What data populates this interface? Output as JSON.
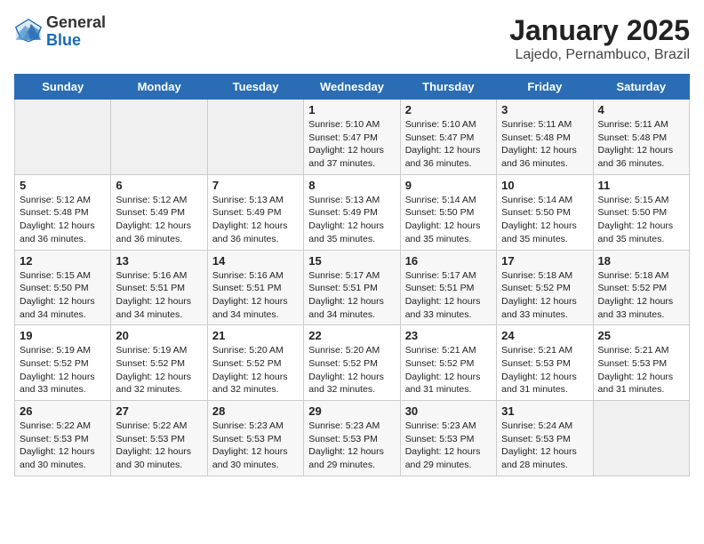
{
  "logo": {
    "general": "General",
    "blue": "Blue"
  },
  "title": "January 2025",
  "subtitle": "Lajedo, Pernambuco, Brazil",
  "weekdays": [
    "Sunday",
    "Monday",
    "Tuesday",
    "Wednesday",
    "Thursday",
    "Friday",
    "Saturday"
  ],
  "weeks": [
    [
      {
        "day": "",
        "info": ""
      },
      {
        "day": "",
        "info": ""
      },
      {
        "day": "",
        "info": ""
      },
      {
        "day": "1",
        "info": "Sunrise: 5:10 AM\nSunset: 5:47 PM\nDaylight: 12 hours\nand 37 minutes."
      },
      {
        "day": "2",
        "info": "Sunrise: 5:10 AM\nSunset: 5:47 PM\nDaylight: 12 hours\nand 36 minutes."
      },
      {
        "day": "3",
        "info": "Sunrise: 5:11 AM\nSunset: 5:48 PM\nDaylight: 12 hours\nand 36 minutes."
      },
      {
        "day": "4",
        "info": "Sunrise: 5:11 AM\nSunset: 5:48 PM\nDaylight: 12 hours\nand 36 minutes."
      }
    ],
    [
      {
        "day": "5",
        "info": "Sunrise: 5:12 AM\nSunset: 5:48 PM\nDaylight: 12 hours\nand 36 minutes."
      },
      {
        "day": "6",
        "info": "Sunrise: 5:12 AM\nSunset: 5:49 PM\nDaylight: 12 hours\nand 36 minutes."
      },
      {
        "day": "7",
        "info": "Sunrise: 5:13 AM\nSunset: 5:49 PM\nDaylight: 12 hours\nand 36 minutes."
      },
      {
        "day": "8",
        "info": "Sunrise: 5:13 AM\nSunset: 5:49 PM\nDaylight: 12 hours\nand 35 minutes."
      },
      {
        "day": "9",
        "info": "Sunrise: 5:14 AM\nSunset: 5:50 PM\nDaylight: 12 hours\nand 35 minutes."
      },
      {
        "day": "10",
        "info": "Sunrise: 5:14 AM\nSunset: 5:50 PM\nDaylight: 12 hours\nand 35 minutes."
      },
      {
        "day": "11",
        "info": "Sunrise: 5:15 AM\nSunset: 5:50 PM\nDaylight: 12 hours\nand 35 minutes."
      }
    ],
    [
      {
        "day": "12",
        "info": "Sunrise: 5:15 AM\nSunset: 5:50 PM\nDaylight: 12 hours\nand 34 minutes."
      },
      {
        "day": "13",
        "info": "Sunrise: 5:16 AM\nSunset: 5:51 PM\nDaylight: 12 hours\nand 34 minutes."
      },
      {
        "day": "14",
        "info": "Sunrise: 5:16 AM\nSunset: 5:51 PM\nDaylight: 12 hours\nand 34 minutes."
      },
      {
        "day": "15",
        "info": "Sunrise: 5:17 AM\nSunset: 5:51 PM\nDaylight: 12 hours\nand 34 minutes."
      },
      {
        "day": "16",
        "info": "Sunrise: 5:17 AM\nSunset: 5:51 PM\nDaylight: 12 hours\nand 33 minutes."
      },
      {
        "day": "17",
        "info": "Sunrise: 5:18 AM\nSunset: 5:52 PM\nDaylight: 12 hours\nand 33 minutes."
      },
      {
        "day": "18",
        "info": "Sunrise: 5:18 AM\nSunset: 5:52 PM\nDaylight: 12 hours\nand 33 minutes."
      }
    ],
    [
      {
        "day": "19",
        "info": "Sunrise: 5:19 AM\nSunset: 5:52 PM\nDaylight: 12 hours\nand 33 minutes."
      },
      {
        "day": "20",
        "info": "Sunrise: 5:19 AM\nSunset: 5:52 PM\nDaylight: 12 hours\nand 32 minutes."
      },
      {
        "day": "21",
        "info": "Sunrise: 5:20 AM\nSunset: 5:52 PM\nDaylight: 12 hours\nand 32 minutes."
      },
      {
        "day": "22",
        "info": "Sunrise: 5:20 AM\nSunset: 5:52 PM\nDaylight: 12 hours\nand 32 minutes."
      },
      {
        "day": "23",
        "info": "Sunrise: 5:21 AM\nSunset: 5:52 PM\nDaylight: 12 hours\nand 31 minutes."
      },
      {
        "day": "24",
        "info": "Sunrise: 5:21 AM\nSunset: 5:53 PM\nDaylight: 12 hours\nand 31 minutes."
      },
      {
        "day": "25",
        "info": "Sunrise: 5:21 AM\nSunset: 5:53 PM\nDaylight: 12 hours\nand 31 minutes."
      }
    ],
    [
      {
        "day": "26",
        "info": "Sunrise: 5:22 AM\nSunset: 5:53 PM\nDaylight: 12 hours\nand 30 minutes."
      },
      {
        "day": "27",
        "info": "Sunrise: 5:22 AM\nSunset: 5:53 PM\nDaylight: 12 hours\nand 30 minutes."
      },
      {
        "day": "28",
        "info": "Sunrise: 5:23 AM\nSunset: 5:53 PM\nDaylight: 12 hours\nand 30 minutes."
      },
      {
        "day": "29",
        "info": "Sunrise: 5:23 AM\nSunset: 5:53 PM\nDaylight: 12 hours\nand 29 minutes."
      },
      {
        "day": "30",
        "info": "Sunrise: 5:23 AM\nSunset: 5:53 PM\nDaylight: 12 hours\nand 29 minutes."
      },
      {
        "day": "31",
        "info": "Sunrise: 5:24 AM\nSunset: 5:53 PM\nDaylight: 12 hours\nand 28 minutes."
      },
      {
        "day": "",
        "info": ""
      }
    ]
  ]
}
